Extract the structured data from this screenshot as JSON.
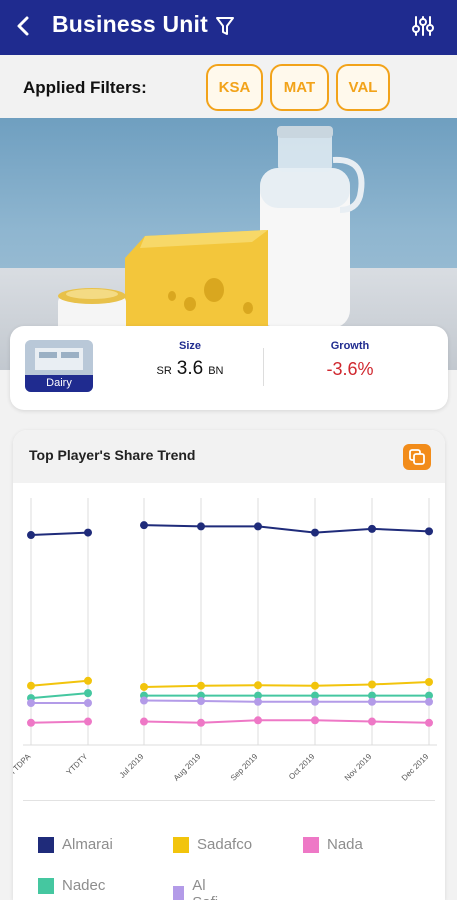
{
  "header": {
    "title": "Business Unit"
  },
  "filters": {
    "label": "Applied Filters:",
    "chips": [
      "KSA",
      "MAT",
      "VAL"
    ]
  },
  "summary": {
    "category": "Dairy",
    "size": {
      "label": "Size",
      "currency": "SR",
      "value": "3.6",
      "unit": "BN"
    },
    "growth": {
      "label": "Growth",
      "value": "-3.6%"
    }
  },
  "chart": {
    "title": "Top Player's Share Trend"
  },
  "chart_data": {
    "type": "line",
    "title": "Top Player's Share Trend",
    "x": [
      "YTDPA",
      "YTDTY",
      "Jul 2019",
      "Aug 2019",
      "Sep 2019",
      "Oct 2019",
      "Nov 2019",
      "Dec 2019"
    ],
    "series": [
      {
        "name": "Almarai",
        "color": "#1f2b7a",
        "values": [
          85,
          86,
          null,
          89,
          88.5,
          88.5,
          86,
          87.5,
          86.5
        ]
      },
      {
        "name": "Sadafco",
        "color": "#f2c40c",
        "values": [
          24,
          26,
          null,
          23.5,
          24,
          24.2,
          24,
          24.5,
          25.5
        ]
      },
      {
        "name": "Nadec",
        "color": "#45c7a0",
        "values": [
          19,
          21,
          null,
          20,
          20,
          20,
          20,
          20,
          20
        ]
      },
      {
        "name": "Al Safi",
        "color": "#b39be8",
        "values": [
          17,
          17,
          null,
          18,
          17.8,
          17.5,
          17.5,
          17.5,
          17.5
        ]
      },
      {
        "name": "Nada",
        "color": "#ee78c6",
        "values": [
          9,
          9.5,
          null,
          9.5,
          9,
          10,
          10,
          9.5,
          9
        ]
      }
    ],
    "ylim": [
      0,
      100
    ],
    "grid": "vertical",
    "legend": "bottom"
  },
  "legend": [
    {
      "name": "Almarai",
      "color": "#1f2b7a"
    },
    {
      "name": "Sadafco",
      "color": "#f2c40c"
    },
    {
      "name": "Nada",
      "color": "#ee78c6"
    },
    {
      "name": "Nadec",
      "color": "#45c7a0"
    },
    {
      "name": "Al Safi",
      "color": "#b39be8"
    }
  ]
}
